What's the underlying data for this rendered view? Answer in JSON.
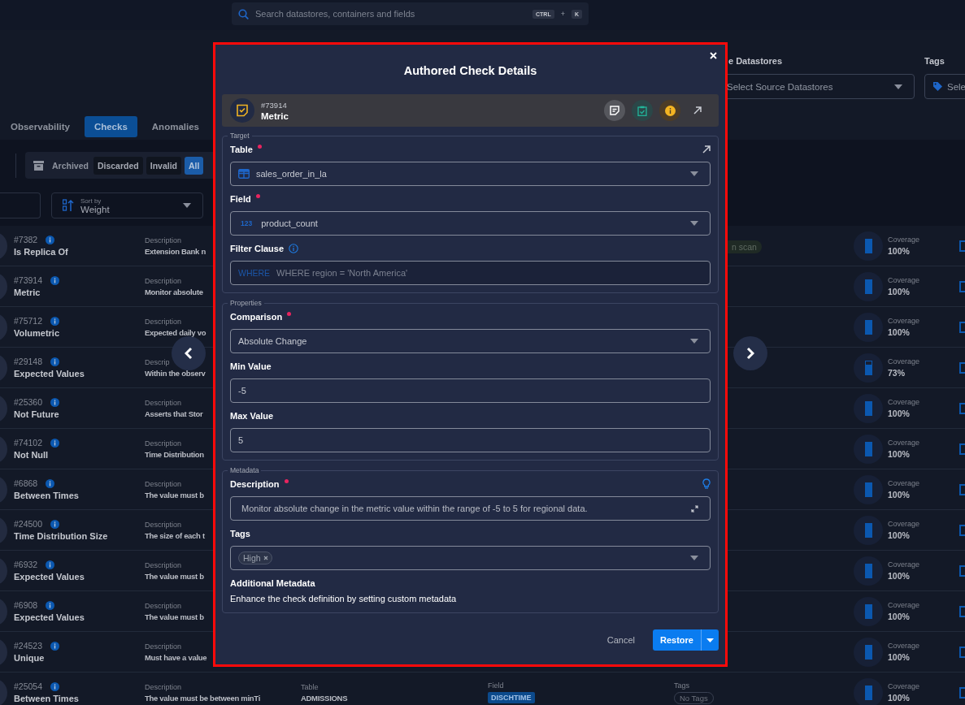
{
  "search": {
    "placeholder": "Search datastores, containers and fields",
    "keys": [
      "CTRL",
      "K"
    ],
    "joiner": "+"
  },
  "filters": [
    {
      "kind": "select",
      "label": "e Datastores",
      "placeholder": "Select Source Datastores"
    },
    {
      "kind": "tags",
      "label": "Tags",
      "placeholder": "Sele"
    }
  ],
  "tabs": [
    {
      "label": "Observability",
      "selected": false
    },
    {
      "label": "Checks",
      "selected": true
    },
    {
      "label": "Anomalies",
      "selected": false
    }
  ],
  "status_group": {
    "label": "Archived",
    "options": [
      {
        "label": "Discarded",
        "selected": false
      },
      {
        "label": "Invalid",
        "selected": false
      },
      {
        "label": "All",
        "selected": true
      }
    ]
  },
  "sort": {
    "label": "Sort by",
    "value": "Weight"
  },
  "rows": [
    {
      "id": "#7382",
      "name": "Is Replica Of",
      "description_label": "Description",
      "description": "Extension Bank n",
      "tag": "n scan",
      "coverage_label": "Coverage",
      "coverage": "100%",
      "level": 1
    },
    {
      "id": "#73914",
      "name": "Metric",
      "description_label": "Description",
      "description": "Monitor absolute",
      "coverage_label": "Coverage",
      "coverage": "100%",
      "level": 1
    },
    {
      "id": "#75712",
      "name": "Volumetric",
      "description_label": "Description",
      "description": "Expected daily vo",
      "coverage_label": "Coverage",
      "coverage": "100%",
      "level": 1
    },
    {
      "id": "#29148",
      "name": "Expected Values",
      "description_label": "Descrip",
      "description": "Within the observ",
      "coverage_label": "Coverage",
      "coverage": "73%",
      "level": 0.73
    },
    {
      "id": "#25360",
      "name": "Not Future",
      "description_label": "Description",
      "description": "Asserts that Stor",
      "coverage_label": "Coverage",
      "coverage": "100%",
      "level": 1
    },
    {
      "id": "#74102",
      "name": "Not Null",
      "description_label": "Description",
      "description": "Time Distribution",
      "coverage_label": "Coverage",
      "coverage": "100%",
      "level": 1
    },
    {
      "id": "#6868",
      "name": "Between Times",
      "description_label": "Description",
      "description": "The value must b",
      "coverage_label": "Coverage",
      "coverage": "100%",
      "level": 1
    },
    {
      "id": "#24500",
      "name": "Time Distribution Size",
      "description_label": "Description",
      "description": "The size of each t",
      "coverage_label": "Coverage",
      "coverage": "100%",
      "level": 1
    },
    {
      "id": "#6932",
      "name": "Expected Values",
      "description_label": "Description",
      "description": "The value must b",
      "coverage_label": "Coverage",
      "coverage": "100%",
      "level": 1
    },
    {
      "id": "#6908",
      "name": "Expected Values",
      "description_label": "Description",
      "description": "The value must b",
      "coverage_label": "Coverage",
      "coverage": "100%",
      "level": 1
    },
    {
      "id": "#24523",
      "name": "Unique",
      "description_label": "Description",
      "description": "Must have a value",
      "coverage_label": "Coverage",
      "coverage": "100%",
      "level": 1
    },
    {
      "id": "#25054",
      "name": "Between Times",
      "description_label": "Description",
      "description": "The value must be between minTi",
      "table_label": "Table",
      "table": "ADMISSIONS",
      "field_label": "Field",
      "field": "DISCHTIME",
      "tags_label": "Tags",
      "tags_empty": "No Tags",
      "coverage_label": "Coverage",
      "coverage": "100%",
      "level": 1
    }
  ],
  "modal": {
    "title": "Authored Check Details",
    "check": {
      "id": "#73914",
      "name": "Metric"
    },
    "sections": [
      {
        "legend": "Target",
        "fields": [
          {
            "kind": "table_select",
            "label": "Table",
            "required": true,
            "link": true,
            "value": "sales_order_in_la"
          },
          {
            "kind": "select",
            "label": "Field",
            "required": true,
            "type_badge": "123",
            "value": "product_count"
          },
          {
            "kind": "input",
            "label": "Filter Clause",
            "required": false,
            "info": true,
            "prefix": "WHERE",
            "placeholder": "WHERE region = 'North America'"
          }
        ]
      },
      {
        "legend": "Properties",
        "fields": [
          {
            "kind": "select",
            "label": "Comparison",
            "required": true,
            "value": "Absolute Change"
          },
          {
            "kind": "input",
            "label": "Min Value",
            "required": false,
            "value": "-5"
          },
          {
            "kind": "input",
            "label": "Max Value",
            "required": false,
            "value": "5"
          }
        ]
      },
      {
        "legend": "Metadata",
        "fields": [
          {
            "kind": "textarea",
            "label": "Description",
            "required": true,
            "hint": true,
            "value": "Monitor absolute change in the metric value within the range of -5 to 5 for regional data."
          },
          {
            "kind": "tags",
            "label": "Tags",
            "required": false,
            "tags": [
              "High"
            ]
          },
          {
            "kind": "note",
            "label": "Additional Metadata",
            "text": "Enhance the check definition by setting custom metadata"
          }
        ]
      }
    ],
    "buttons": {
      "cancel": "Cancel",
      "primary": "Restore"
    }
  }
}
